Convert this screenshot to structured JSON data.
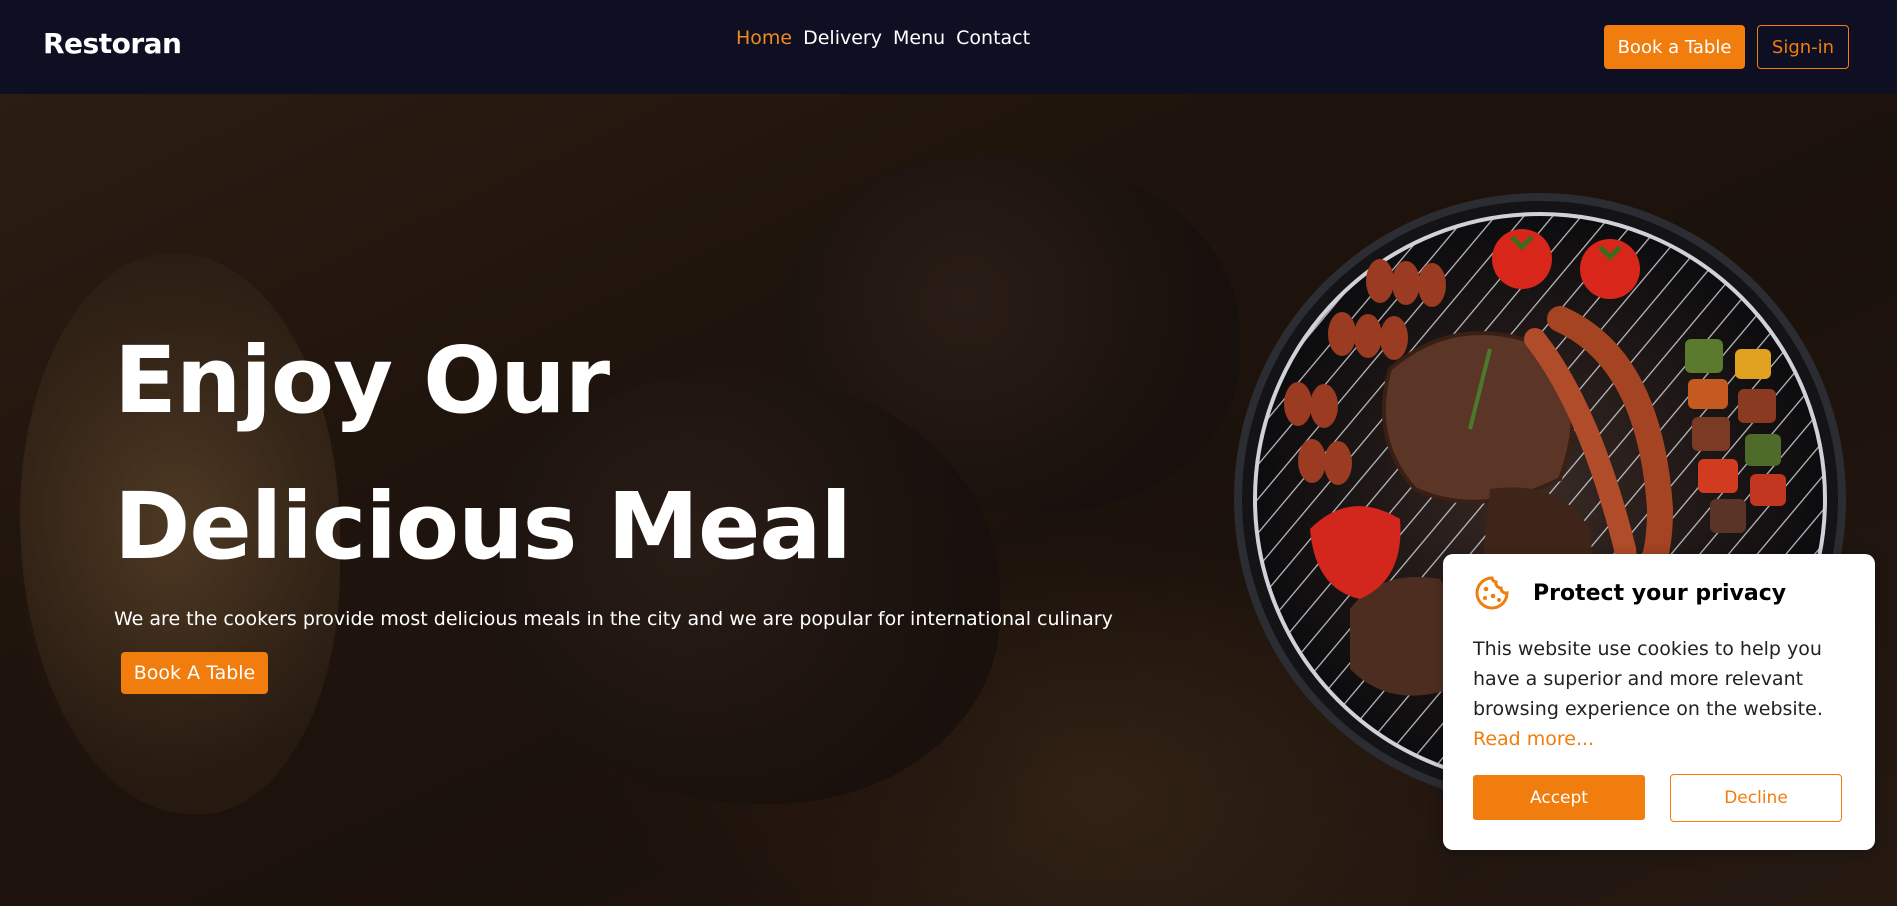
{
  "navbar": {
    "brand": "Restoran",
    "links": [
      {
        "label": "Home",
        "active": true
      },
      {
        "label": "Delivery",
        "active": false
      },
      {
        "label": "Menu",
        "active": false
      },
      {
        "label": "Contact",
        "active": false
      }
    ],
    "book_button": "Book a Table",
    "signin_button": "Sign-in"
  },
  "hero": {
    "title_line1": "Enjoy Our",
    "title_line2": "Delicious Meal",
    "subtitle": "We are the cookers provide most delicious meals in the city and we are popular for international culinary",
    "book_button": "Book A Table",
    "image_icon": "grill-food-image"
  },
  "cookie_banner": {
    "icon": "cookie-icon",
    "title": "Protect your privacy",
    "text": "This website use cookies to help you have a superior and more relevant browsing experience on the website.",
    "link": "Read more...",
    "accept_button": "Accept",
    "decline_button": "Decline"
  },
  "colors": {
    "accent": "#f07d0d",
    "navbar_bg": "#0f0f24",
    "text_light": "#ffffff"
  }
}
